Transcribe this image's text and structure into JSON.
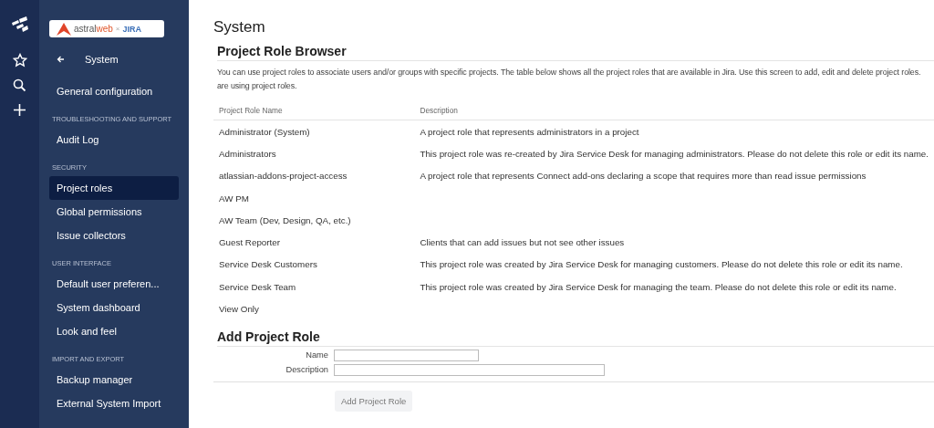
{
  "logo": {
    "brand_first": "astral",
    "brand_second": "web",
    "separator": "×",
    "product": "JIRA"
  },
  "sidebar": {
    "back_label": "System",
    "sections": [
      {
        "items": [
          {
            "label": "General configuration",
            "selected": false
          }
        ]
      },
      {
        "heading": "TROUBLESHOOTING AND SUPPORT",
        "items": [
          {
            "label": "Audit Log",
            "selected": false
          }
        ]
      },
      {
        "heading": "SECURITY",
        "items": [
          {
            "label": "Project roles",
            "selected": true
          },
          {
            "label": "Global permissions",
            "selected": false
          },
          {
            "label": "Issue collectors",
            "selected": false
          }
        ]
      },
      {
        "heading": "USER INTERFACE",
        "items": [
          {
            "label": "Default user preferen...",
            "selected": false
          },
          {
            "label": "System dashboard",
            "selected": false
          },
          {
            "label": "Look and feel",
            "selected": false
          }
        ]
      },
      {
        "heading": "IMPORT AND EXPORT",
        "items": [
          {
            "label": "Backup manager",
            "selected": false
          },
          {
            "label": "External System Import",
            "selected": false
          }
        ]
      }
    ]
  },
  "page_title": "System",
  "browser": {
    "title": "Project Role Browser",
    "intro_lines": [
      "You can use project roles to associate users and/or groups with specific projects. The table below shows all the project roles that are available in Jira. Use this screen to add, edit and delete project roles.",
      "are using project roles."
    ],
    "table": {
      "columns": [
        "Project Role Name",
        "Description"
      ],
      "rows": [
        [
          "Administrator (System)",
          "A project role that represents administrators in a project"
        ],
        [
          "Administrators",
          "This project role was re-created by Jira Service Desk for managing administrators. Please do not delete this role or edit its name."
        ],
        [
          "atlassian-addons-project-access",
          "A project role that represents Connect add-ons declaring a scope that requires more than read issue permissions"
        ],
        [
          "AW PM",
          ""
        ],
        [
          "AW Team (Dev, Design, QA, etc.)",
          ""
        ],
        [
          "Guest Reporter",
          "Clients that can add issues but not see other issues"
        ],
        [
          "Service Desk Customers",
          "This project role was created by Jira Service Desk for managing customers. Please do not delete this role or edit its name."
        ],
        [
          "Service Desk Team",
          "This project role was created by Jira Service Desk for managing the team. Please do not delete this role or edit its name."
        ],
        [
          "View Only",
          ""
        ]
      ]
    }
  },
  "add_form": {
    "title": "Add Project Role",
    "fields": [
      {
        "label": "Name",
        "kind": "short"
      },
      {
        "label": "Description",
        "kind": "long"
      }
    ],
    "submit": "Add Project Role",
    "submit_disabled": true
  }
}
